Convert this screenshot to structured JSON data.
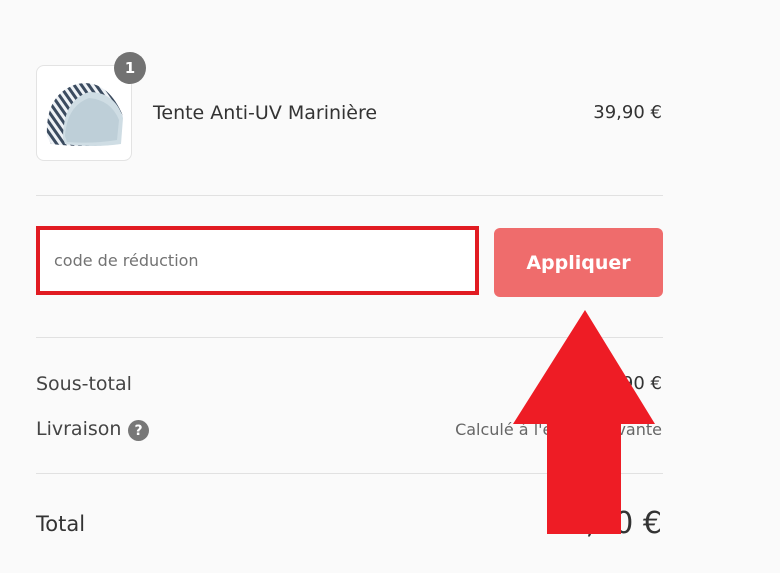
{
  "product": {
    "quantity": "1",
    "name": "Tente Anti-UV Marinière",
    "price": "39,90 €",
    "image_icon": "striped-tent-icon"
  },
  "discount": {
    "placeholder": "code de réduction",
    "value": "",
    "apply_label": "Appliquer"
  },
  "summary": {
    "subtotal_label": "Sous-total",
    "subtotal_value": "39,90 €",
    "shipping_label": "Livraison",
    "shipping_help_icon": "?",
    "shipping_value": "Calculé à l'étape suivante",
    "total_label": "Total",
    "total_value": "39,90 €"
  },
  "colors": {
    "highlight_red": "#e11b22",
    "button_bg": "#ef6c6c",
    "badge_bg": "#727272"
  }
}
